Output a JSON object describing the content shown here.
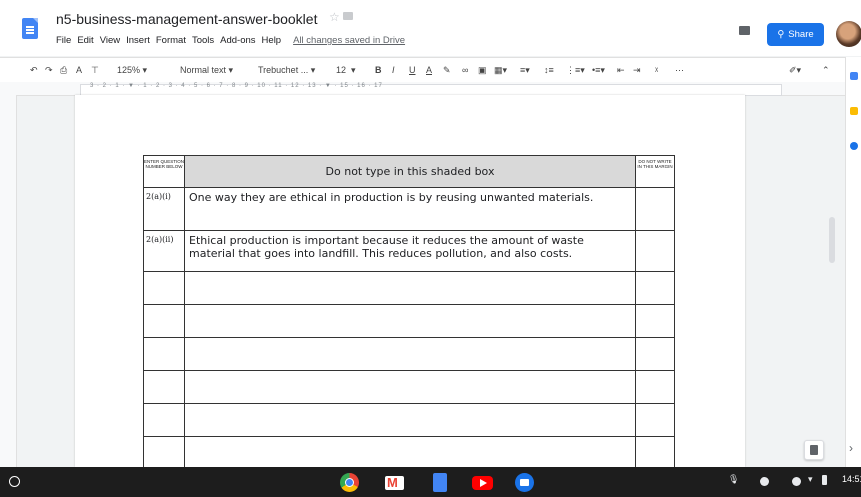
{
  "doc": {
    "title": "n5-business-management-answer-booklet",
    "menus": [
      "File",
      "Edit",
      "View",
      "Insert",
      "Format",
      "Tools",
      "Add-ons",
      "Help"
    ],
    "save_status": "All changes saved in Drive",
    "share_label": "Share"
  },
  "toolbar": {
    "zoom": "125%",
    "style": "Normal text",
    "font": "Trebuchet ...",
    "font_size": "12",
    "bold": "B",
    "italic": "I",
    "underline": "U",
    "text_color": "A",
    "more": "⋯"
  },
  "ruler": {
    "numbers": "3 · 2 · 1 · ▼ · 1 · 2 · 3 · 4 · 5 · 6 · 7 · 8 · 9 · 10 · 11 · 12 · 13 · ▼ · 15 · 16 · 17"
  },
  "table": {
    "col1_header": "ENTER QUESTION NUMBER BELOW",
    "col2_header": "Do not type in this shaded box",
    "col3_header": "DO NOT WRITE IN THIS MARGIN",
    "rows": [
      {
        "qnum": "2(a)(i)",
        "answer": "One way they are ethical in production is by reusing unwanted materials."
      },
      {
        "qnum": "2(a)(ii)",
        "answer": "Ethical  production is important because it reduces the amount of waste material that goes into landfill. This reduces pollution, and also costs."
      }
    ]
  },
  "taskbar": {
    "clock": "14:51",
    "apps": [
      "chrome-icon",
      "gmail-icon",
      "docs-icon",
      "youtube-icon",
      "files-icon"
    ]
  },
  "colors": {
    "share_blue": "#1a73e8",
    "shaded_box": "#d9d9d9",
    "taskbar": "#1d1d1d"
  }
}
